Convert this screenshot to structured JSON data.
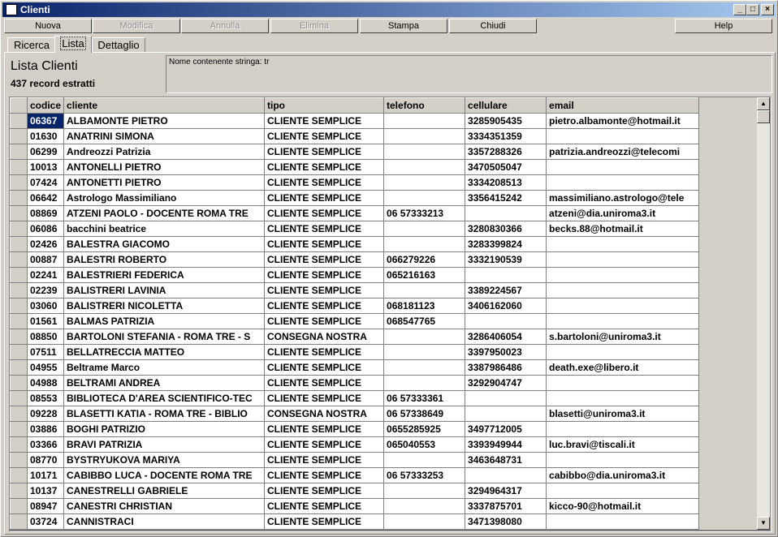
{
  "window": {
    "title": "Clienti"
  },
  "title_controls": {
    "minimize": "_",
    "maximize": "□",
    "close": "×"
  },
  "toolbar": {
    "nuova": "Nuova",
    "modifica": "Modifica",
    "annulla": "Annulla",
    "elimina": "Elimina",
    "stampa": "Stampa",
    "chiudi": "Chiudi",
    "help": "Help"
  },
  "tabs": {
    "ricerca": "Ricerca",
    "lista": "Lista",
    "dettaglio": "Dettaglio"
  },
  "header": {
    "title": "Lista Clienti",
    "count": "437 record estratti"
  },
  "filter": {
    "text": "Nome contenente stringa: tr"
  },
  "table": {
    "columns": [
      "codice",
      "cliente",
      "tipo",
      "telefono",
      "cellulare",
      "email"
    ],
    "rows": [
      [
        "06367",
        "ALBAMONTE PIETRO",
        "CLIENTE SEMPLICE",
        "",
        "3285905435",
        "pietro.albamonte@hotmail.it"
      ],
      [
        "01630",
        "ANATRINI SIMONA",
        "CLIENTE SEMPLICE",
        "",
        "3334351359",
        ""
      ],
      [
        "06299",
        "Andreozzi Patrizia",
        "CLIENTE SEMPLICE",
        "",
        "3357288326",
        "patrizia.andreozzi@telecomi"
      ],
      [
        "10013",
        "ANTONELLI PIETRO",
        "CLIENTE SEMPLICE",
        "",
        "3470505047",
        ""
      ],
      [
        "07424",
        "ANTONETTI PIETRO",
        "CLIENTE SEMPLICE",
        "",
        "3334208513",
        ""
      ],
      [
        "06642",
        "Astrologo Massimiliano",
        "CLIENTE SEMPLICE",
        "",
        "3356415242",
        "massimiliano.astrologo@tele"
      ],
      [
        "08869",
        "ATZENI PAOLO - DOCENTE ROMA TRE",
        "CLIENTE SEMPLICE",
        "06 57333213",
        "",
        "atzeni@dia.uniroma3.it"
      ],
      [
        "06086",
        "bacchini beatrice",
        "CLIENTE SEMPLICE",
        "",
        "3280830366",
        "becks.88@hotmail.it"
      ],
      [
        "02426",
        "BALESTRA GIACOMO",
        "CLIENTE SEMPLICE",
        "",
        "3283399824",
        ""
      ],
      [
        "00887",
        "BALESTRI ROBERTO",
        "CLIENTE SEMPLICE",
        "066279226",
        "3332190539",
        ""
      ],
      [
        "02241",
        "BALESTRIERI FEDERICA",
        "CLIENTE SEMPLICE",
        "065216163",
        "",
        ""
      ],
      [
        "02239",
        "BALISTRERI LAVINIA",
        "CLIENTE SEMPLICE",
        "",
        "3389224567",
        ""
      ],
      [
        "03060",
        "BALISTRERI NICOLETTA",
        "CLIENTE SEMPLICE",
        "068181123",
        "3406162060",
        ""
      ],
      [
        "01561",
        "BALMAS PATRIZIA",
        "CLIENTE SEMPLICE",
        "068547765",
        "",
        ""
      ],
      [
        "08850",
        "BARTOLONI STEFANIA - ROMA TRE - S",
        "CONSEGNA NOSTRA",
        "",
        "3286406054",
        "s.bartoloni@uniroma3.it"
      ],
      [
        "07511",
        "BELLATRECCIA MATTEO",
        "CLIENTE SEMPLICE",
        "",
        "3397950023",
        ""
      ],
      [
        "04955",
        "Beltrame Marco",
        "CLIENTE SEMPLICE",
        "",
        "3387986486",
        "death.exe@libero.it"
      ],
      [
        "04988",
        "BELTRAMI ANDREA",
        "CLIENTE SEMPLICE",
        "",
        "3292904747",
        ""
      ],
      [
        "08553",
        "BIBLIOTECA D'AREA SCIENTIFICO-TEC",
        "CLIENTE SEMPLICE",
        "06 57333361",
        "",
        ""
      ],
      [
        "09228",
        "BLASETTI KATIA - ROMA TRE - BIBLIO",
        "CONSEGNA NOSTRA",
        "06 57338649",
        "",
        "blasetti@uniroma3.it"
      ],
      [
        "03886",
        "BOGHI PATRIZIO",
        "CLIENTE SEMPLICE",
        "0655285925",
        "3497712005",
        ""
      ],
      [
        "03366",
        "BRAVI PATRIZIA",
        "CLIENTE SEMPLICE",
        "065040553",
        "3393949944",
        "luc.bravi@tiscali.it"
      ],
      [
        "08770",
        "BYSTRYUKOVA MARIYA",
        "CLIENTE SEMPLICE",
        "",
        "3463648731",
        ""
      ],
      [
        "10171",
        "CABIBBO LUCA - DOCENTE ROMA TRE",
        "CLIENTE SEMPLICE",
        "06 57333253",
        "",
        "cabibbo@dia.uniroma3.it"
      ],
      [
        "10137",
        "CANESTRELLI GABRIELE",
        "CLIENTE SEMPLICE",
        "",
        "3294964317",
        ""
      ],
      [
        "08947",
        "CANESTRI CHRISTIAN",
        "CLIENTE SEMPLICE",
        "",
        "3337875701",
        "kicco-90@hotmail.it"
      ],
      [
        "03724",
        "CANNISTRACI",
        "CLIENTE SEMPLICE",
        "",
        "3471398080",
        ""
      ]
    ]
  },
  "scrollbar": {
    "up": "▲",
    "down": "▼"
  }
}
